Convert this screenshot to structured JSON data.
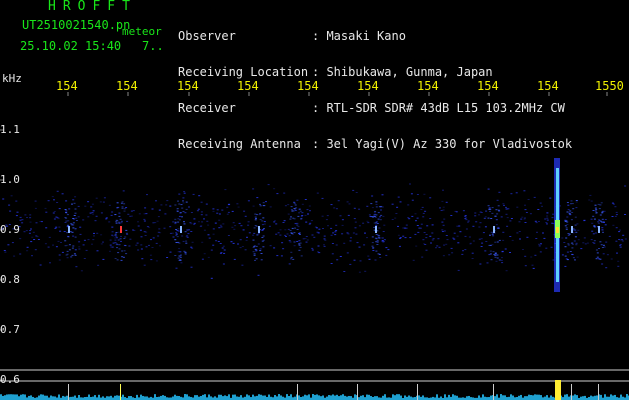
{
  "header": {
    "title": "HROFFT",
    "filename": "UT2510021540.pn",
    "meteor_label": "meteor",
    "datetime": "25.10.02 15:40",
    "count": "7.."
  },
  "info": {
    "labels": [
      "Observer",
      "Receiving Location",
      "Receiver",
      "Receiving Antenna"
    ],
    "values": [
      ": Masaki Kano",
      ": Shibukawa, Gunma, Japan",
      ": RTL-SDR SDR# 43dB L15 103.2MHz CW",
      ": 3el Yagi(V) Az 330 for Vladivostok"
    ]
  },
  "chart_data": {
    "type": "heatmap",
    "yunit": "kHz",
    "y_ticks": [
      "1.1",
      "1.0",
      "0.9",
      "0.8",
      "0.7",
      "0.6"
    ],
    "x_ticks": [
      "154",
      "154",
      "154",
      "154",
      "154",
      "154",
      "154",
      "154",
      "154",
      "1550"
    ],
    "ylim": [
      0.6,
      1.1
    ],
    "signal_band_khz": 0.9,
    "meteor_event": {
      "x_label": "154",
      "freq_range_khz": [
        0.8,
        1.0
      ]
    }
  },
  "colors": {
    "background": "#000000",
    "grid": "#cfcfcf",
    "signal": "#2a3cff",
    "meteor": "#5fd0ff",
    "tick_text": "#f0f000",
    "axis_text": "#e8e8e8"
  }
}
